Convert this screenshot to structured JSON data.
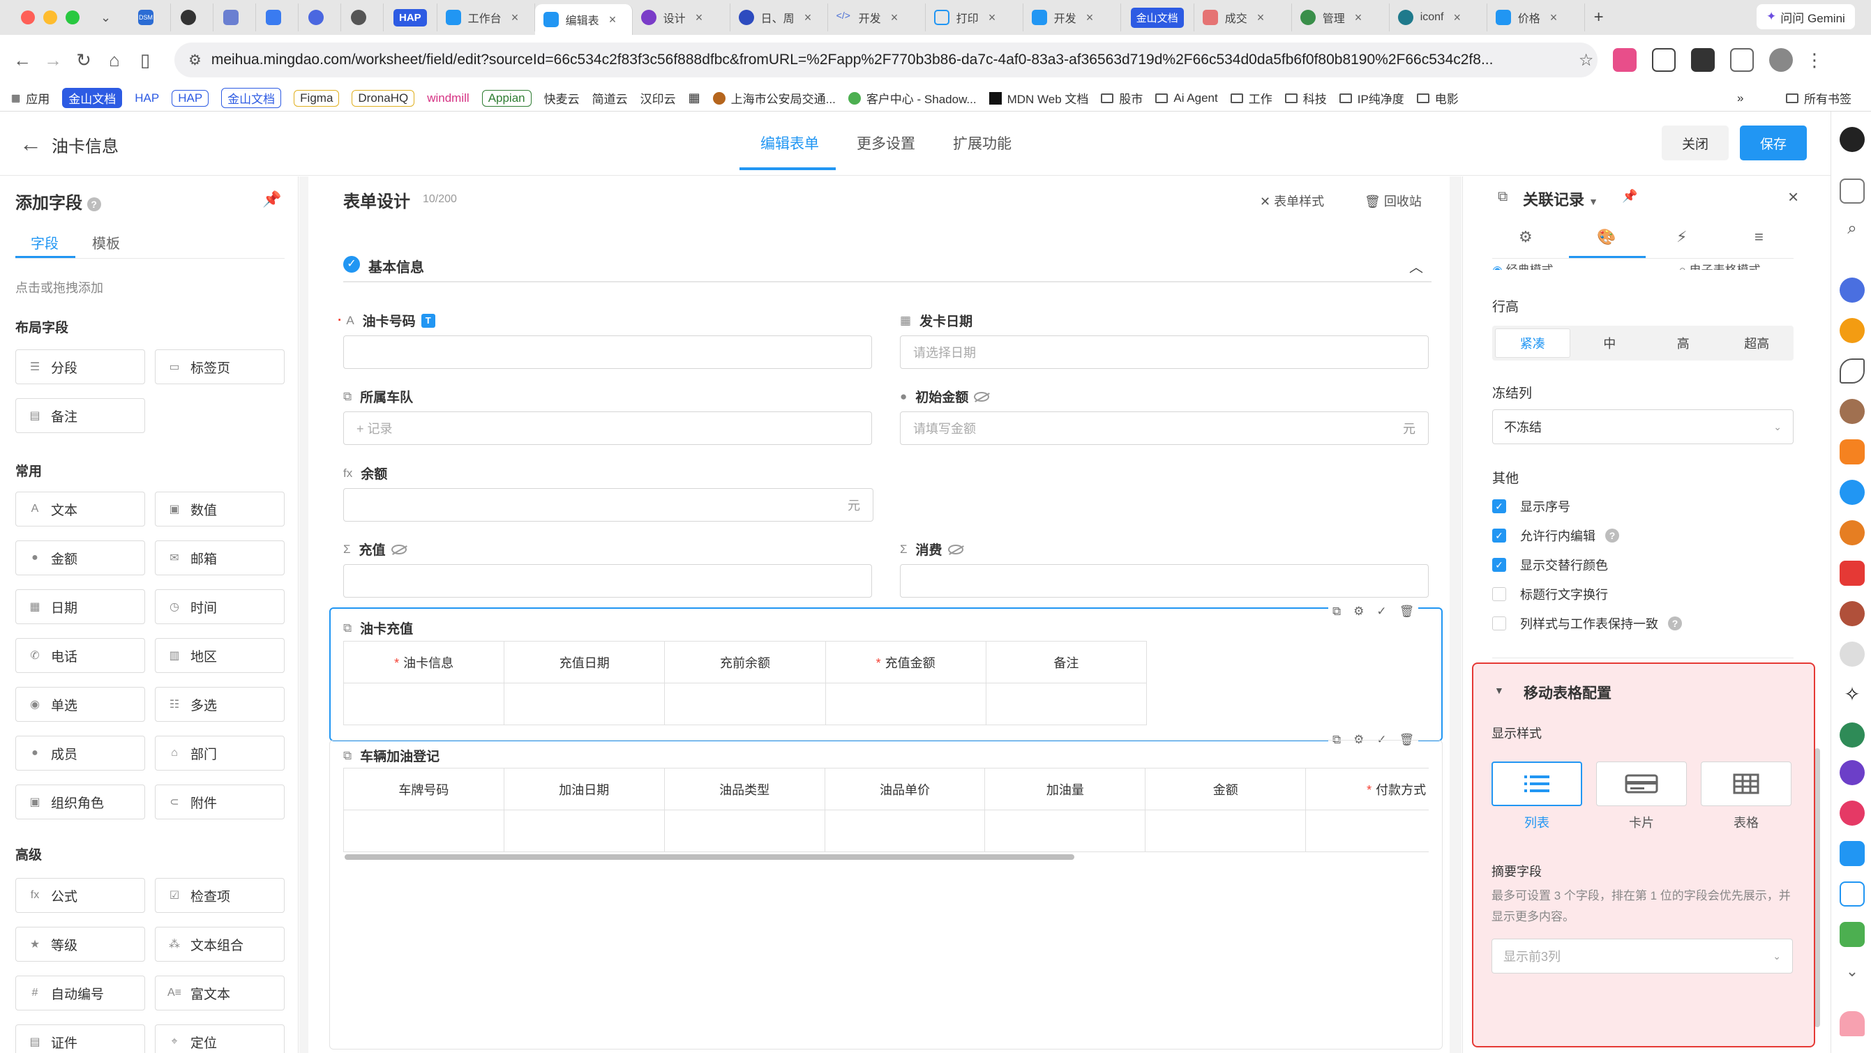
{
  "browser": {
    "tabs": [
      {
        "label": "",
        "color": "#2b6cd4",
        "badge": "DSM"
      },
      {
        "label": "",
        "color": "#333333"
      },
      {
        "label": "",
        "color": "#6a7fd1"
      },
      {
        "label": "",
        "color": "#3a7bf0"
      },
      {
        "label": "",
        "color": "#4a67e0"
      },
      {
        "label": "",
        "color": "#333333"
      },
      {
        "label": "HAP",
        "color": "#2d5be3"
      },
      {
        "label": "工作台",
        "color": "#2196f3"
      },
      {
        "label": "编辑表",
        "color": "#2196f3",
        "active": true
      },
      {
        "label": "设计",
        "color": "#7a3cc8"
      },
      {
        "label": "日、周",
        "color": "#2d4bbf"
      },
      {
        "label": "开发",
        "color": "#4a6fd4"
      },
      {
        "label": "打印",
        "color": "#2196f3"
      },
      {
        "label": "开发",
        "color": "#2196f3"
      },
      {
        "label": "金山文档",
        "color": "#2d5be3"
      },
      {
        "label": "成交",
        "color": "#e57373"
      },
      {
        "label": "管理",
        "color": "#3a8f4a"
      },
      {
        "label": "iconf",
        "color": "#1f7a8c"
      },
      {
        "label": "价格",
        "color": "#2196f3"
      }
    ],
    "gemini_label": "问问 Gemini",
    "url": "meihua.mingdao.com/worksheet/field/edit?sourceId=66c534c2f83f3c56f888dfbc&fromURL=%2Fapp%2F770b3b86-da7c-4af0-83a3-af36563d719d%2F66c534d0da5fb6f0f80b8190%2F66c534c2f8...",
    "bookmarks": [
      {
        "label": "应用",
        "type": "grid"
      },
      {
        "label": "金山文档",
        "type": "badge-blue"
      },
      {
        "label": "HAP",
        "type": "plain"
      },
      {
        "label": "HAP",
        "type": "badge-blue"
      },
      {
        "label": "金山文档",
        "type": "badge-blue"
      },
      {
        "label": "Figma",
        "type": "badge-yellow"
      },
      {
        "label": "DronaHQ",
        "type": "badge-yellow"
      },
      {
        "label": "windmill",
        "type": "plain-pink"
      },
      {
        "label": "Appian",
        "type": "badge-green"
      },
      {
        "label": "快麦云",
        "type": "plain"
      },
      {
        "label": "简道云",
        "type": "plain"
      },
      {
        "label": "汉印云",
        "type": "plain"
      },
      {
        "label": "上海市公安局交通...",
        "type": "plain"
      },
      {
        "label": "客户中心 - Shadow...",
        "type": "plain"
      },
      {
        "label": "MDN Web 文档",
        "type": "plain"
      },
      {
        "label": "股市",
        "type": "folder"
      },
      {
        "label": "Ai Agent",
        "type": "folder"
      },
      {
        "label": "工作",
        "type": "folder"
      },
      {
        "label": "科技",
        "type": "folder"
      },
      {
        "label": "IP纯净度",
        "type": "folder"
      },
      {
        "label": "电影",
        "type": "folder"
      }
    ],
    "all_bookmarks": "所有书签"
  },
  "header": {
    "title": "油卡信息",
    "tabs": [
      "编辑表单",
      "更多设置",
      "扩展功能"
    ],
    "close_label": "关闭",
    "save_label": "保存"
  },
  "left_panel": {
    "title": "添加字段",
    "tabs": [
      "字段",
      "模板"
    ],
    "hint": "点击或拖拽添加",
    "sections": {
      "layout": "布局字段",
      "common": "常用",
      "advanced": "高级"
    },
    "layout_fields": [
      "分段",
      "标签页",
      "备注"
    ],
    "common_fields": [
      "文本",
      "数值",
      "金额",
      "邮箱",
      "日期",
      "时间",
      "电话",
      "地区",
      "单选",
      "多选",
      "成员",
      "部门",
      "组织角色",
      "附件"
    ],
    "advanced_fields": [
      "公式",
      "检查项",
      "等级",
      "文本组合",
      "自动编号",
      "富文本",
      "证件",
      "定位"
    ]
  },
  "form": {
    "title": "表单设计",
    "count": "10/200",
    "style_action": "表单样式",
    "recycle_action": "回收站",
    "section_title": "基本信息",
    "fields": {
      "card_no": {
        "label": "油卡号码",
        "badge": "T"
      },
      "issue_date": {
        "label": "发卡日期",
        "placeholder": "请选择日期"
      },
      "team": {
        "label": "所属车队",
        "placeholder": "+ 记录"
      },
      "initial_amount": {
        "label": "初始金额",
        "placeholder": "请填写金额",
        "unit": "元"
      },
      "balance": {
        "label": "余额",
        "unit": "元"
      },
      "recharge": {
        "label": "充值"
      },
      "consume": {
        "label": "消费"
      }
    },
    "subtable1": {
      "title": "油卡充值",
      "columns": [
        {
          "label": "油卡信息",
          "required": true
        },
        {
          "label": "充值日期",
          "required": false
        },
        {
          "label": "充前余额",
          "required": false
        },
        {
          "label": "充值金额",
          "required": true
        },
        {
          "label": "备注",
          "required": false
        }
      ]
    },
    "subtable2": {
      "title": "车辆加油登记",
      "columns": [
        {
          "label": "车牌号码",
          "required": false
        },
        {
          "label": "加油日期",
          "required": false
        },
        {
          "label": "油品类型",
          "required": false
        },
        {
          "label": "油品单价",
          "required": false
        },
        {
          "label": "加油量",
          "required": false
        },
        {
          "label": "金额",
          "required": false
        },
        {
          "label": "付款方式",
          "required": true
        }
      ]
    }
  },
  "right_panel": {
    "title": "关联记录",
    "mode_classic": "经典模式",
    "mode_sheet": "电子表格模式",
    "row_height_label": "行高",
    "row_heights": [
      "紧凑",
      "中",
      "高",
      "超高"
    ],
    "freeze_label": "冻结列",
    "freeze_value": "不冻结",
    "other_label": "其他",
    "options": [
      {
        "label": "显示序号",
        "checked": true,
        "help": false
      },
      {
        "label": "允许行内编辑",
        "checked": true,
        "help": true
      },
      {
        "label": "显示交替行颜色",
        "checked": true,
        "help": false
      },
      {
        "label": "标题行文字换行",
        "checked": false,
        "help": false
      },
      {
        "label": "列样式与工作表保持一致",
        "checked": false,
        "help": true
      }
    ],
    "mobile": {
      "title": "移动表格配置",
      "display_style_label": "显示样式",
      "styles": [
        "列表",
        "卡片",
        "表格"
      ],
      "summary_label": "摘要字段",
      "summary_desc": "最多可设置 3 个字段，排在第 1 位的字段会优先展示，并显示更多内容。",
      "summary_placeholder": "显示前3列"
    }
  },
  "colors": {
    "accent": "#2196f3",
    "highlight_border": "#e53935",
    "highlight_bg": "#fde8ea",
    "required": "#f44336"
  }
}
